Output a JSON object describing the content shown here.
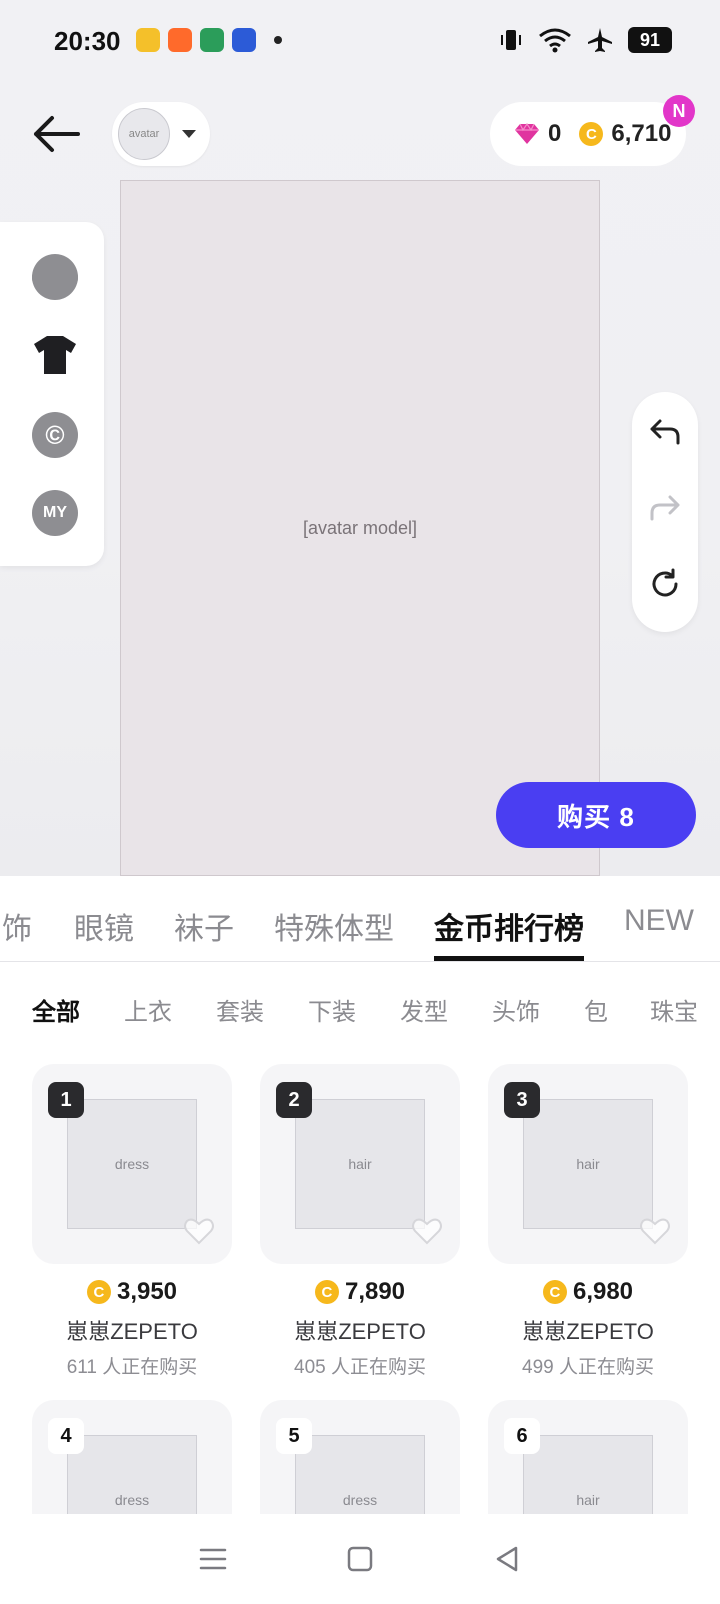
{
  "status_bar": {
    "time": "20:30",
    "battery": "91",
    "app_icons": [
      "#f4c02a",
      "#ff6a2b",
      "#2b9d5a",
      "#2c5bd7"
    ]
  },
  "header": {
    "diamonds": "0",
    "coins": "6,710",
    "notification_badge": "N",
    "avatar_placeholder": "avatar"
  },
  "side_panel": {
    "copyright_glyph": "©",
    "my_label": "MY"
  },
  "stage": {
    "model_placeholder": "[avatar model]"
  },
  "buy_button_label": "购买 8",
  "category_tabs": [
    {
      "label": "饰",
      "active": false
    },
    {
      "label": "眼镜",
      "active": false
    },
    {
      "label": "袜子",
      "active": false
    },
    {
      "label": "特殊体型",
      "active": false
    },
    {
      "label": "金币排行榜",
      "active": true
    },
    {
      "label": "NEW",
      "active": false
    }
  ],
  "filters": [
    {
      "label": "全部",
      "active": true
    },
    {
      "label": "上衣",
      "active": false
    },
    {
      "label": "套装",
      "active": false
    },
    {
      "label": "下装",
      "active": false
    },
    {
      "label": "发型",
      "active": false
    },
    {
      "label": "头饰",
      "active": false
    },
    {
      "label": "包",
      "active": false
    },
    {
      "label": "珠宝",
      "active": false
    }
  ],
  "items": [
    {
      "rank": "1",
      "price": "3,950",
      "seller": "崽崽ZEPETO",
      "buyers": "611 人正在购买",
      "image": "dress"
    },
    {
      "rank": "2",
      "price": "7,890",
      "seller": "崽崽ZEPETO",
      "buyers": "405 人正在购买",
      "image": "hair"
    },
    {
      "rank": "3",
      "price": "6,980",
      "seller": "崽崽ZEPETO",
      "buyers": "499 人正在购买",
      "image": "hair"
    },
    {
      "rank": "4",
      "image": "dress"
    },
    {
      "rank": "5",
      "image": "dress"
    },
    {
      "rank": "6",
      "image": "hair"
    }
  ],
  "colors": {
    "accent": "#4a3ef2",
    "coin": "#f6b81c",
    "badge": "#e236c9",
    "diamond": "#e0349f"
  },
  "icons": {
    "back": "arrow-left-icon",
    "undo": "undo-icon",
    "redo": "redo-icon",
    "reset": "refresh-icon",
    "favorite": "heart-icon",
    "diamond": "diamond-icon",
    "coin": "coin-icon",
    "nav_menu": "menu-icon",
    "nav_home": "square-home-icon",
    "nav_back": "triangle-back-icon"
  }
}
